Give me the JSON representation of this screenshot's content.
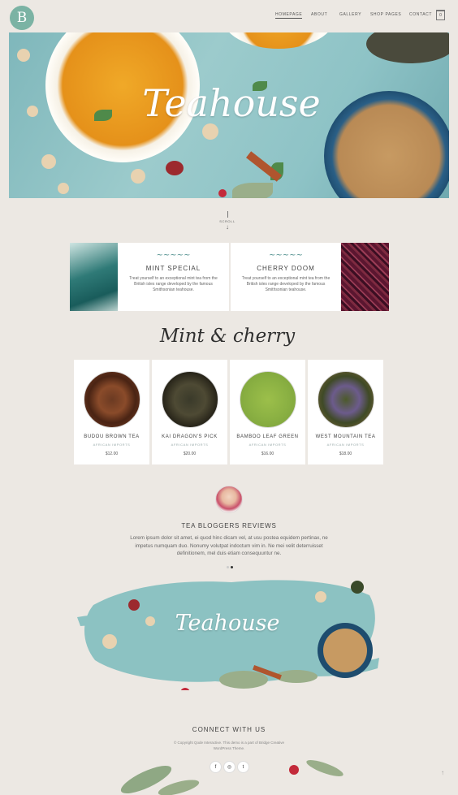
{
  "header": {
    "logo_letter": "B",
    "nav": [
      "HOMEPAGE",
      "ABOUT",
      "GALLERY",
      "SHOP PAGES",
      "CONTACT"
    ],
    "cart_count": "0"
  },
  "hero": {
    "title": "Teahouse"
  },
  "scroll": {
    "label": "SCROLL",
    "arrow": "↓"
  },
  "features": [
    {
      "title": "MINT SPECIAL",
      "text": "Treat yourself to an exceptional mint tea from the British isles range developed by the famous Smithsonian teahouse."
    },
    {
      "title": "CHERRY DOOM",
      "text": "Treat yourself to an exceptional mint tea from the British isles range developed by the famous Smithsonian teahouse."
    }
  ],
  "section": {
    "title": "Mint & cherry"
  },
  "products": [
    {
      "name": "BUDOU BROWN TEA",
      "sub": "AFRICAN IMPORTS",
      "price": "$12.00"
    },
    {
      "name": "KAI DRAGON'S PICK",
      "sub": "AFRICAN IMPORTS",
      "price": "$20.00"
    },
    {
      "name": "BAMBOO LEAF GREEN",
      "sub": "AFRICAN IMPORTS",
      "price": "$16.00"
    },
    {
      "name": "WEST MOUNTAIN TEA",
      "sub": "AFRICAN IMPORTS",
      "price": "$18.00"
    }
  ],
  "reviews": {
    "title": "TEA BLOGGERS REVIEWS",
    "text": "Lorem ipsum dolor sit amet, ei quod hinc dicam vel, at usu postea equidem pertinax, ne impetus numquam duo. Nonumy volutpat indoctum vim in. Ne mei velit deterruisset definitionem, mel duis etiam consequuntur ne."
  },
  "banner": {
    "title": "Teahouse"
  },
  "footer": {
    "connect": "CONNECT WITH US",
    "copyright": "© Copyright Qode Interactive. This demo is a part of Bridge Creative WordPress Theme.",
    "social": [
      "f",
      "◎",
      "t"
    ],
    "to_top": "↑"
  },
  "colors": {
    "accent": "#7bb3a4",
    "teal": "#8ec3c6",
    "background": "#ece8e3"
  }
}
